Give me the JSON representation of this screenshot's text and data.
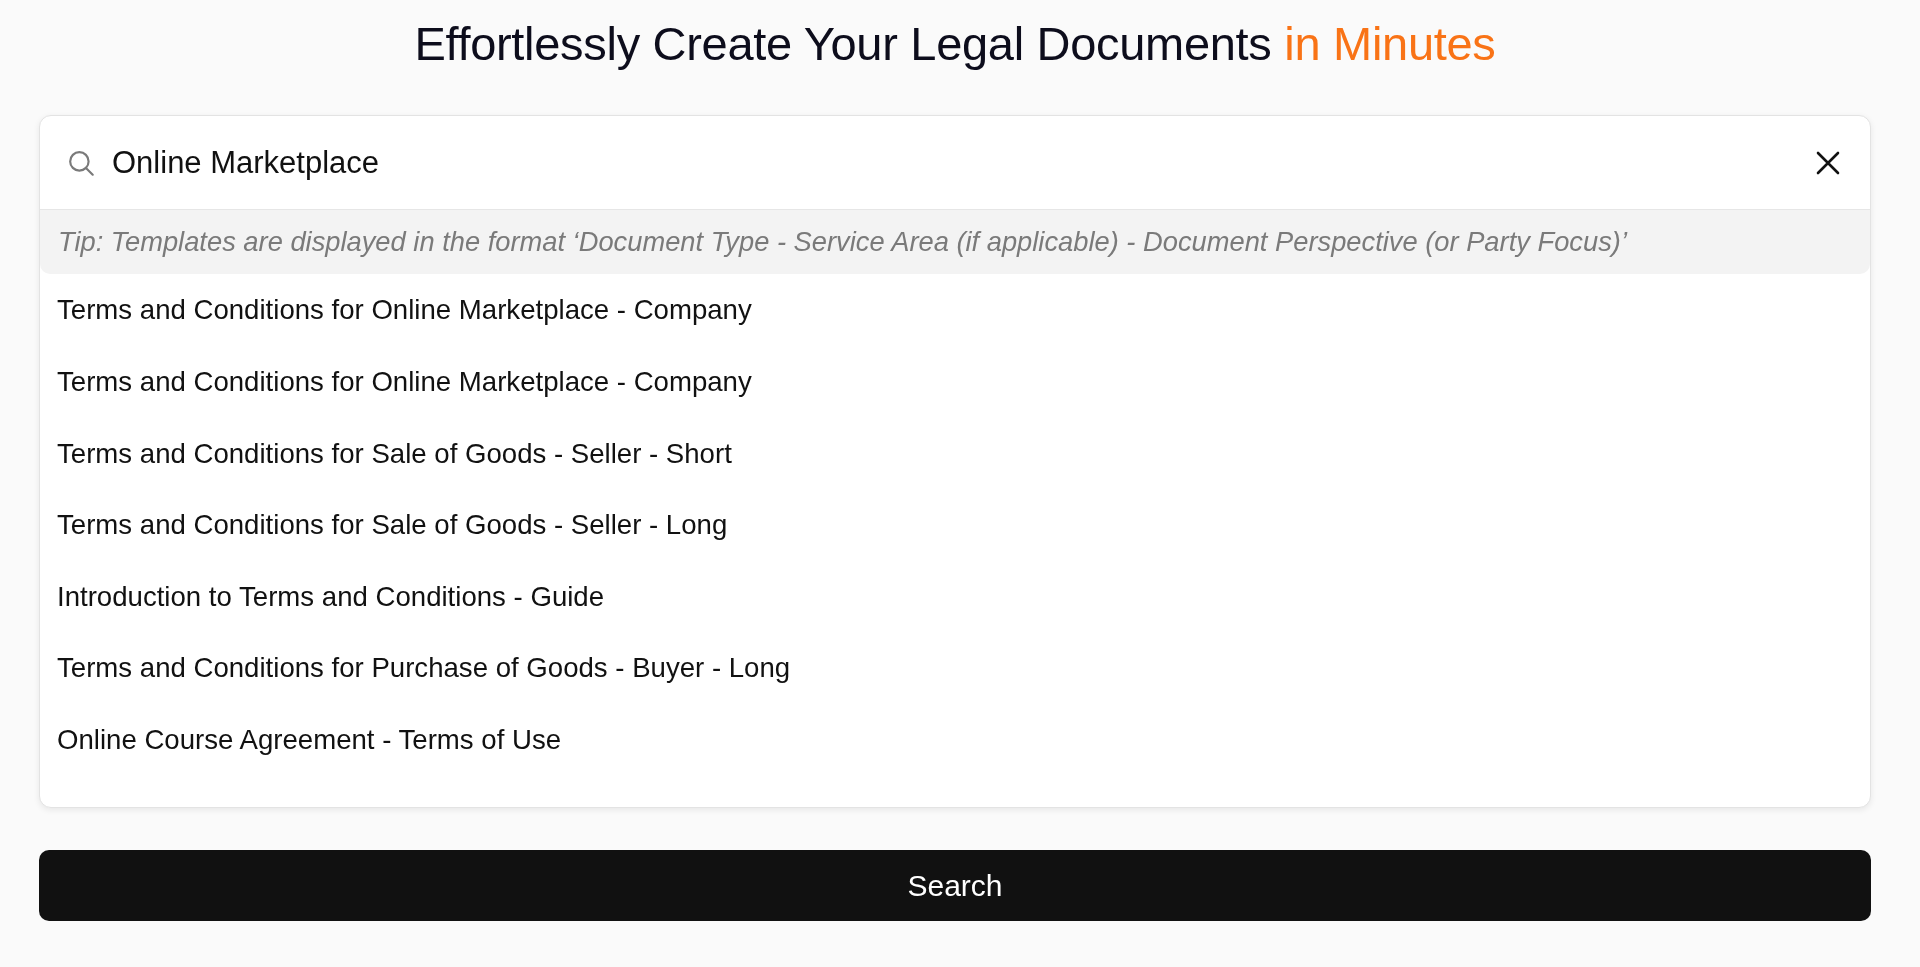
{
  "heading": {
    "text": "Effortlessly Create Your Legal Documents",
    "highlight": "in Minutes"
  },
  "search": {
    "value": "Online Marketplace"
  },
  "dropdown": {
    "tip": "Tip: Templates are displayed in the format ‘Document Type - Service Area (if applicable) - Document Perspective (or Party Focus)’",
    "items": [
      "Terms and Conditions for Online Marketplace - Company",
      "Terms and Conditions for Online Marketplace - Company",
      "Terms and Conditions for Sale of Goods - Seller - Short",
      "Terms and Conditions for Sale of Goods - Seller - Long",
      "Introduction to Terms and Conditions - Guide",
      "Terms and Conditions for Purchase of Goods - Buyer - Long",
      "Online Course Agreement - Terms of Use"
    ]
  },
  "button": {
    "label": "Search"
  }
}
